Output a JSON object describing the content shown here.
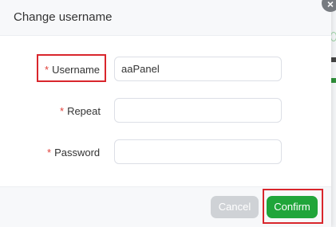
{
  "dialog": {
    "title": "Change username",
    "close_glyph": "×"
  },
  "form": {
    "required_mark": "*",
    "username": {
      "label": "Username",
      "value": "aaPanel"
    },
    "repeat": {
      "label": "Repeat",
      "value": ""
    },
    "password": {
      "label": "Password",
      "value": ""
    }
  },
  "footer": {
    "cancel_label": "Cancel",
    "confirm_label": "Confirm"
  },
  "colors": {
    "accent": "#20a53a",
    "highlight": "#d9262c",
    "required": "#e0403a",
    "cancel_disabled": "#cfd2d6"
  },
  "icons": {
    "close": "close-icon"
  }
}
